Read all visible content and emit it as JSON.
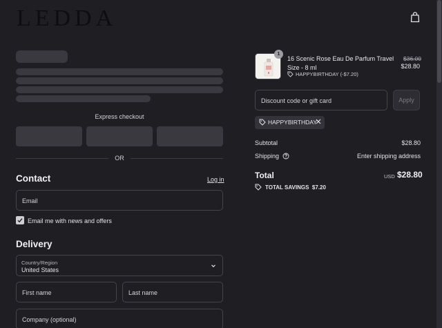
{
  "brand": {
    "logo_text": "LEDDA"
  },
  "express": {
    "label": "Express checkout",
    "or_label": "OR"
  },
  "contact": {
    "title": "Contact",
    "login_label": "Log in",
    "email_placeholder": "Email",
    "newsletter_label": "Email me with news and offers",
    "newsletter_checked": true
  },
  "delivery": {
    "title": "Delivery",
    "country_label": "Country/Region",
    "country_value": "United States",
    "first_name_placeholder": "First name",
    "last_name_placeholder": "Last name",
    "company_placeholder": "Company (optional)"
  },
  "cart": {
    "item": {
      "quantity": "1",
      "name": "16 Scenic Rose Eau De Parfum Travel Size - 8 ml",
      "original_price": "$36.00",
      "price": "$28.80",
      "discount": "HAPPYBIRTHDAY (-$7.20)"
    },
    "discount_placeholder": "Discount code or gift card",
    "apply_label": "Apply",
    "applied_code": "HAPPYBIRTHDAY",
    "subtotal_label": "Subtotal",
    "subtotal_value": "$28.80",
    "shipping_label": "Shipping",
    "shipping_value": "Enter shipping address",
    "total_label": "Total",
    "total_currency": "USD",
    "total_value": "$28.80",
    "savings_label": "TOTAL SAVINGS",
    "savings_value": "$7.20"
  },
  "colors": {
    "background": "#1f1e23",
    "field_border": "#45444b",
    "skeleton": "#3a393f"
  }
}
